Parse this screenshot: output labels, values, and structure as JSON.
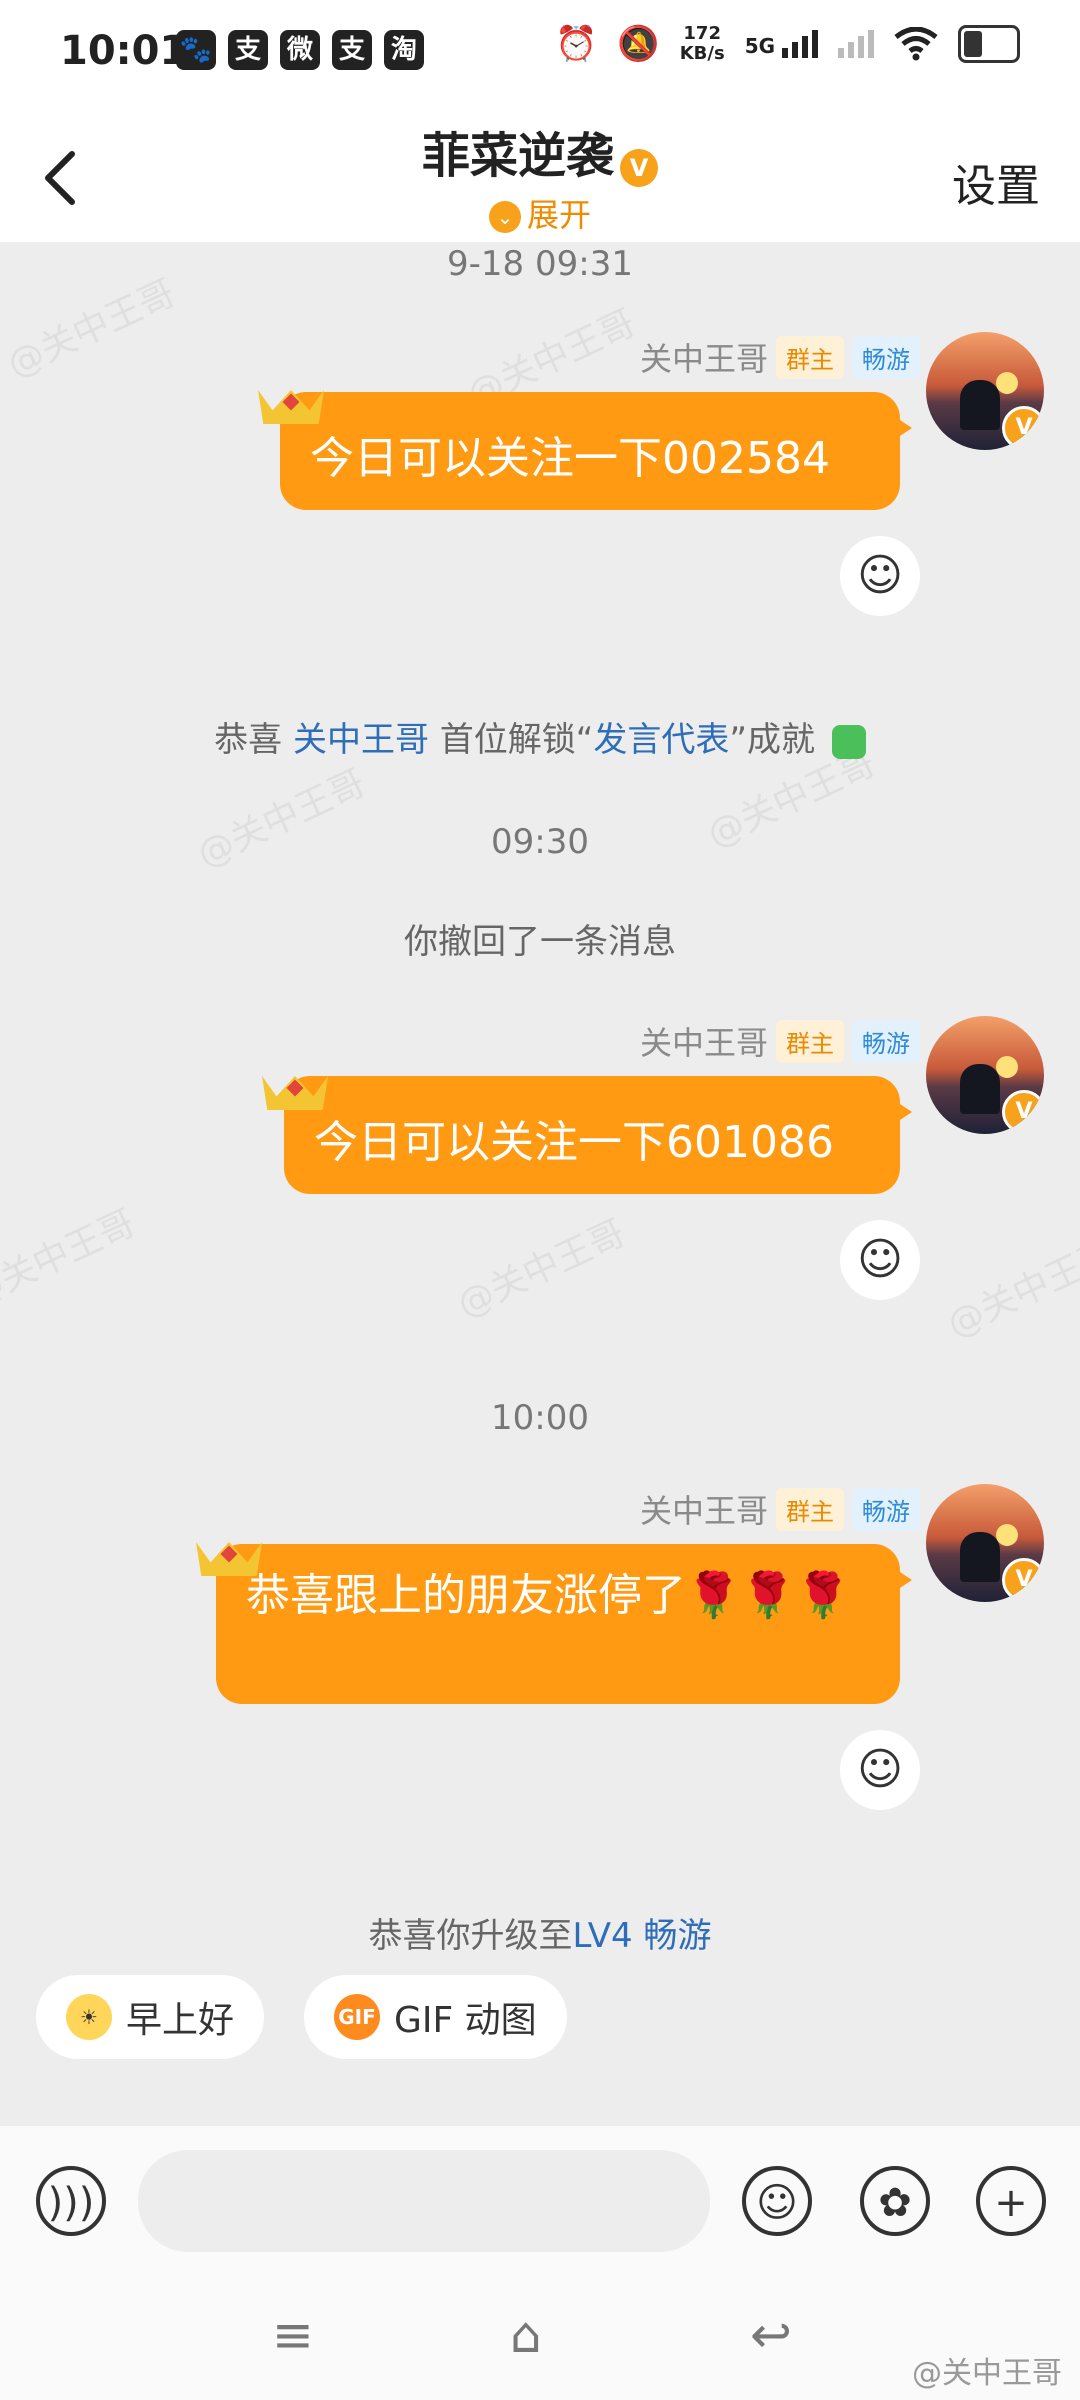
{
  "status_bar": {
    "time": "10:01",
    "app_icons": [
      "🐾",
      "支",
      "微",
      "支",
      "淘"
    ],
    "net_speed": "172",
    "net_unit": "KB/s",
    "signal": "5G"
  },
  "header": {
    "title": "菲菜逆袭",
    "verified_badge": "V",
    "expand_label": "展开",
    "settings_label": "设置"
  },
  "watermark": "@关中王哥",
  "messages": [
    {
      "timestamp": "9-18 09:31",
      "sender": "关中王哥",
      "owner_tag": "群主",
      "level_tag": "畅游",
      "text": "今日可以关注一下002584"
    },
    {
      "timestamp": "09:30",
      "system_line": "你撤回了一条消息",
      "sender": "关中王哥",
      "owner_tag": "群主",
      "level_tag": "畅游",
      "text": "今日可以关注一下601086"
    },
    {
      "timestamp": "10:00",
      "sender": "关中王哥",
      "owner_tag": "群主",
      "level_tag": "畅游",
      "text": "恭喜跟上的朋友涨停了🌹🌹🌹"
    }
  ],
  "achievement": {
    "prefix": "恭喜 ",
    "user": "关中王哥",
    "middle": " 首位解锁“",
    "title": "发言代表",
    "suffix": "”成就"
  },
  "upgrade": {
    "prefix": "恭喜你升级至",
    "level": "LV4 畅游"
  },
  "quick_replies": [
    "早上好",
    "GIF 动图"
  ],
  "gif_badge": "GIF",
  "input_bar": {
    "voice": "voice",
    "emoji": "emoji",
    "sticker": "sticker",
    "plus": "plus"
  },
  "nav": {
    "menu": "≡",
    "home": "⌂",
    "back": "↩"
  },
  "footer_watermark": "@关中王哥"
}
